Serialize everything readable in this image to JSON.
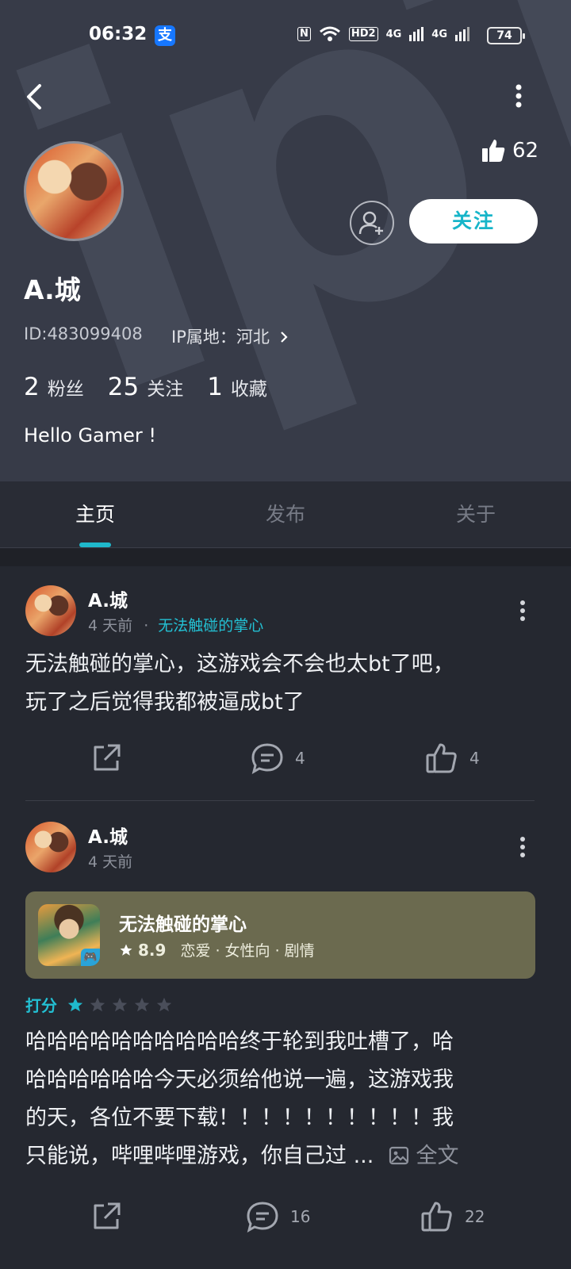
{
  "status_bar": {
    "time": "06:32",
    "alipay_glyph": "支",
    "battery": "74",
    "network_labels": [
      "N",
      "HD2",
      "4G",
      "4G"
    ]
  },
  "header": {
    "likes_count": "62",
    "follow_label": "关注"
  },
  "profile": {
    "name": "A.城",
    "id": "ID:483099408",
    "ip": "IP属地：河北",
    "stats": [
      {
        "value": "2",
        "label": "粉丝"
      },
      {
        "value": "25",
        "label": "关注"
      },
      {
        "value": "1",
        "label": "收藏"
      }
    ],
    "bio": "Hello Gamer !"
  },
  "tabs": [
    {
      "label": "主页",
      "active": true
    },
    {
      "label": "发布",
      "active": false
    },
    {
      "label": "关于",
      "active": false
    }
  ],
  "posts": [
    {
      "author": "A.城",
      "time": "4 天前",
      "separator": "·",
      "tag": "无法触碰的掌心",
      "text_lines": [
        "无法触碰的掌心，这游戏会不会也太bt了吧，",
        "玩了之后觉得我都被逼成bt了"
      ],
      "comments": "4",
      "likes": "4"
    },
    {
      "author": "A.城",
      "time": "4 天前",
      "game": {
        "title": "无法触碰的掌心",
        "score": "8.9",
        "tags": "恋爱 · 女性向 · 剧情",
        "badge": "🎮"
      },
      "rating_label": "打分",
      "rating_value": 1,
      "rating_max": 5,
      "text_lines": [
        "哈哈哈哈哈哈哈哈哈哈终于轮到我吐槽了，哈",
        "哈哈哈哈哈哈今天必须给他说一遍，这游戏我",
        "的天，各位不要下载！！！！！！！！！！我"
      ],
      "last_line": "只能说，哔哩哔哩游戏，你自己过 ...",
      "full_text_label": "全文",
      "comments": "16",
      "likes": "22"
    }
  ],
  "colors": {
    "accent": "#1fb9cc",
    "header_bg": "#373b48",
    "feed_bg": "#252830",
    "card_bg": "#6b6a4f"
  }
}
